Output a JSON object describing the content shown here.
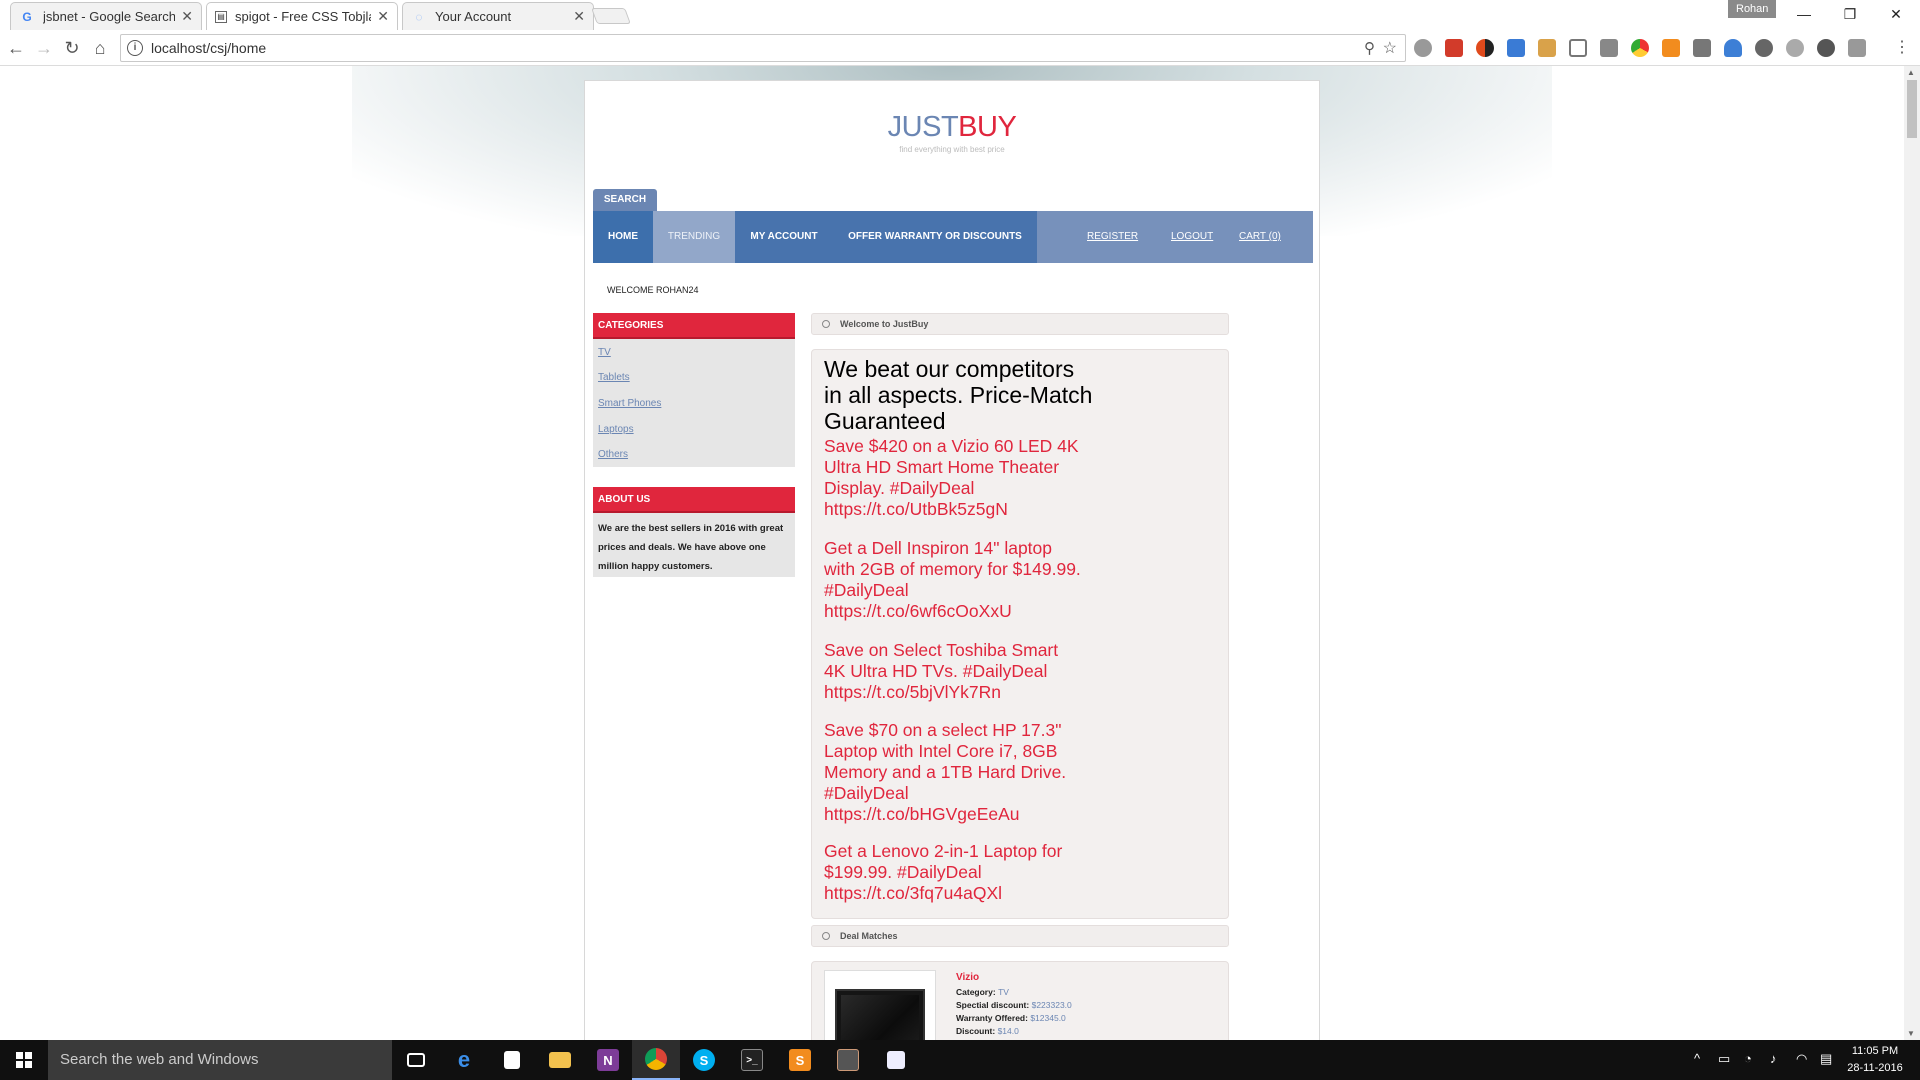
{
  "browser": {
    "tabs": [
      {
        "title": "jsbnet - Google Search",
        "icon": "google-icon"
      },
      {
        "title": "spigot - Free CSS Tobjlat",
        "icon": "page-icon"
      },
      {
        "title": "Your Account",
        "icon": "loading-icon"
      }
    ],
    "profile_name": "Rohan",
    "url": "localhost/csj/home"
  },
  "site": {
    "logo_just": "JUST",
    "logo_buy": "BUY",
    "tagline": "find everything with best price",
    "search_tab": "SEARCH",
    "nav": {
      "home": "HOME",
      "trending": "TRENDING",
      "my_account": "MY ACCOUNT",
      "offer": "OFFER WARRANTY OR DISCOUNTS",
      "register": "REGISTER",
      "logout": "LOGOUT",
      "cart": "CART (0)"
    },
    "welcome": "WELCOME ROHAN24",
    "categories": {
      "title": "CATEGORIES",
      "items": [
        "TV",
        "Tablets",
        "Smart Phones",
        "Laptops",
        "Others"
      ]
    },
    "about": {
      "title": "ABOUT US",
      "text": "We are the best sellers in 2016 with great prices and deals. We have above one million happy customers."
    },
    "welcome_section": {
      "title": "Welcome to JustBuy",
      "headline": "We beat our competitors in all aspects. Price-Match Guaranteed",
      "deals": [
        "Save $420 on a Vizio 60 LED 4K Ultra HD Smart Home Theater Display. #DailyDeal https://t.co/UtbBk5z5gN",
        "Get a Dell Inspiron 14\" laptop with 2GB of memory for $149.99. #DailyDeal https://t.co/6wf6cOoXxU",
        "Save on Select Toshiba Smart 4K Ultra HD TVs. #DailyDeal https://t.co/5bjVlYk7Rn",
        "Save $70 on a select HP 17.3\" Laptop with Intel Core i7, 8GB Memory and a 1TB Hard Drive. #DailyDeal https://t.co/bHGVgeEeAu",
        "Get a Lenovo 2-in-1 Laptop for $199.99. #DailyDeal https://t.co/3fq7u4aQXl"
      ]
    },
    "deal_matches": {
      "title": "Deal Matches",
      "product": {
        "name": "Vizio",
        "category_label": "Category:",
        "category": "TV",
        "discount_label": "Spectial discount:",
        "discount": "$223323.0",
        "warranty_label": "Warranty Offered:",
        "warranty": "$12345.0",
        "disc_label": "Discount:",
        "disc": "$14.0"
      }
    }
  },
  "taskbar": {
    "search_placeholder": "Search the web and Windows",
    "time": "11:05 PM",
    "date": "28-11-2016"
  },
  "colors": {
    "brand_blue": "#6b86b3",
    "brand_red": "#e0263d",
    "nav_dark": "#4873ad"
  }
}
